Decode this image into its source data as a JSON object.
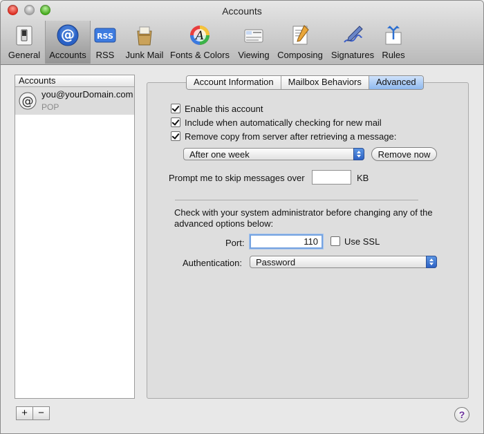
{
  "window": {
    "title": "Accounts"
  },
  "toolbar": {
    "items": [
      {
        "label": "General",
        "icon": "general-switch-icon"
      },
      {
        "label": "Accounts",
        "icon": "at-sign-icon"
      },
      {
        "label": "RSS",
        "icon": "rss-icon"
      },
      {
        "label": "Junk Mail",
        "icon": "junk-mail-icon"
      },
      {
        "label": "Fonts & Colors",
        "icon": "fonts-colors-icon"
      },
      {
        "label": "Viewing",
        "icon": "viewing-icon"
      },
      {
        "label": "Composing",
        "icon": "composing-icon"
      },
      {
        "label": "Signatures",
        "icon": "signatures-icon"
      },
      {
        "label": "Rules",
        "icon": "rules-icon"
      }
    ],
    "selected": "Accounts",
    "rss_badge": "RSS"
  },
  "sidebar": {
    "header": "Accounts",
    "accounts": [
      {
        "email": "you@yourDomain.com",
        "type": "POP"
      }
    ],
    "add_label": "+",
    "remove_label": "−"
  },
  "tabs": [
    {
      "label": "Account Information"
    },
    {
      "label": "Mailbox Behaviors"
    },
    {
      "label": "Advanced",
      "active": true
    }
  ],
  "advanced": {
    "enable_account": {
      "label": "Enable this account",
      "checked": true
    },
    "include_checking": {
      "label": "Include when automatically checking for new mail",
      "checked": true
    },
    "remove_copy": {
      "label": "Remove copy from server after retrieving a message:",
      "checked": true
    },
    "remove_after": {
      "value": "After one week"
    },
    "remove_now_label": "Remove now",
    "prompt_label": "Prompt me to skip messages over",
    "prompt_value": "",
    "prompt_unit": "KB",
    "admin_note_line1": "Check with your system administrator before changing any of the",
    "admin_note_line2": "advanced options below:",
    "port_label": "Port:",
    "port_value": "110",
    "use_ssl": {
      "label": "Use SSL",
      "checked": false
    },
    "auth_label": "Authentication:",
    "auth_value": "Password"
  },
  "help_label": "?",
  "colors": {
    "accent_blue": "#3b73d1",
    "selected_tab": "#8fb9ee",
    "close_button": "#d9281c",
    "zoom_button": "#3fa417"
  }
}
